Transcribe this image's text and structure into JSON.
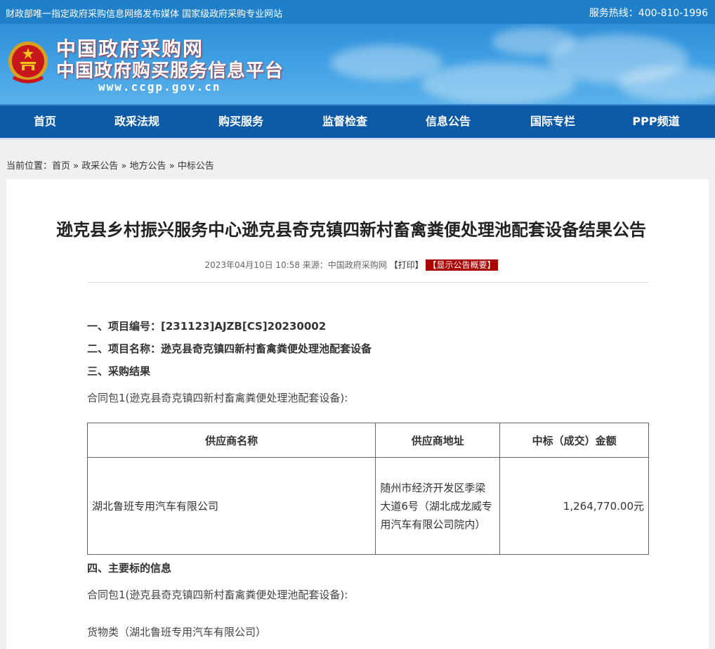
{
  "topbar": {
    "slogan": "财政部唯一指定政府采购信息网络发布媒体 国家级政府采购专业网站",
    "hotline": "服务热线：400-810-1996"
  },
  "header": {
    "site_name": "中国政府采购网",
    "site_subtitle": "中国政府购买服务信息平台",
    "site_url": "www.ccgp.gov.cn"
  },
  "nav": {
    "items": [
      {
        "label": "首页"
      },
      {
        "label": "政采法规"
      },
      {
        "label": "购买服务"
      },
      {
        "label": "监督检查"
      },
      {
        "label": "信息公告"
      },
      {
        "label": "国际专栏"
      },
      {
        "label": "PPP频道"
      }
    ]
  },
  "breadcrumb": {
    "prefix": "当前位置：",
    "items": [
      "首页",
      "政采公告",
      "地方公告",
      "中标公告"
    ],
    "separator": "»"
  },
  "article": {
    "title": "逊克县乡村振兴服务中心逊克县奇克镇四新村畜禽粪便处理池配套设备结果公告",
    "date": "2023年04月10日 10:58",
    "source": "来源：中国政府采购网",
    "print_label": "【打印】",
    "summary_label": "【显示公告概要】",
    "section1": "一、项目编号：[231123]AJZB[CS]20230002",
    "section2": "二、项目名称：逊克县奇克镇四新村畜禽粪便处理池配套设备",
    "section3": "三、采购结果",
    "package_line": "合同包1(逊克县奇克镇四新村畜禽粪便处理池配套设备):",
    "table": {
      "headers": [
        "供应商名称",
        "供应商地址",
        "中标（成交）金额"
      ],
      "rows": [
        {
          "supplier": "湖北鲁班专用汽车有限公司",
          "address": "随州市经济开发区季梁大道6号（湖北成龙威专用汽车有限公司院内）",
          "amount": "1,264,770.00元"
        }
      ]
    },
    "section4": "四、主要标的信息",
    "package_line2": "合同包1(逊克县奇克镇四新村畜禽粪便处理池配套设备):",
    "goods_line": "货物类（湖北鲁班专用汽车有限公司）"
  },
  "colors": {
    "topbar": "#1f7fc8",
    "nav": "#0d5aa6",
    "summary_badge": "#a90000"
  }
}
